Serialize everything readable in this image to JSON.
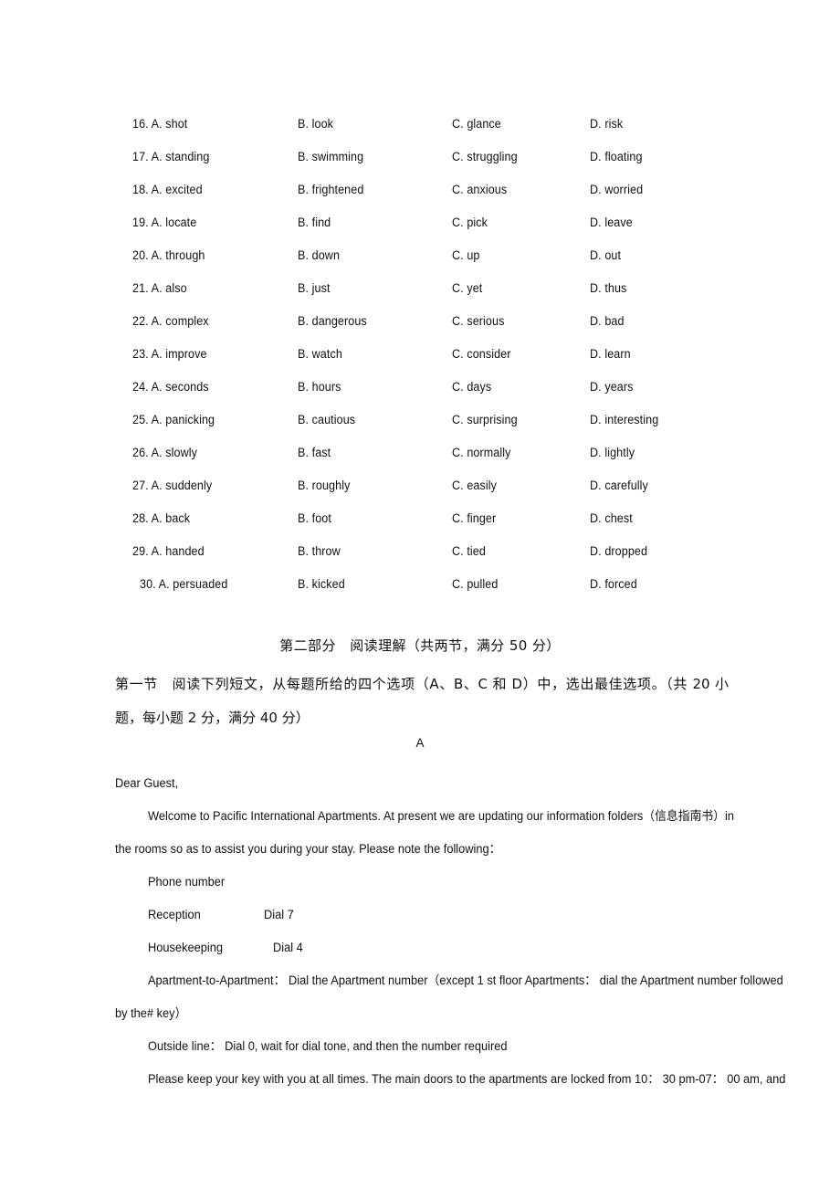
{
  "cloze": {
    "columns": [
      "A",
      "B",
      "C",
      "D"
    ],
    "rows": [
      {
        "number": "16.",
        "a": "16. A. shot",
        "b": "B. look",
        "c": "C. glance",
        "d": "D. risk"
      },
      {
        "number": "17.",
        "a": "17. A. standing",
        "b": "B. swimming",
        "c": "C. struggling",
        "d": "D. floating"
      },
      {
        "number": "18.",
        "a": "18. A. excited",
        "b": "B. frightened",
        "c": "C. anxious",
        "d": "D. worried"
      },
      {
        "number": "19.",
        "a": "19. A. locate",
        "b": "B. find",
        "c": "C. pick",
        "d": "D. leave"
      },
      {
        "number": "20.",
        "a": "20. A. through",
        "b": "B. down",
        "c": "C. up",
        "d": "D. out"
      },
      {
        "number": "21.",
        "a": "21. A. also",
        "b": "B. just",
        "c": "C. yet",
        "d": "D. thus"
      },
      {
        "number": "22.",
        "a": "22. A. complex",
        "b": "B. dangerous",
        "c": "C. serious",
        "d": "D. bad"
      },
      {
        "number": "23.",
        "a": "23. A. improve",
        "b": "B. watch",
        "c": "C. consider",
        "d": "D. learn"
      },
      {
        "number": "24.",
        "a": "24. A. seconds",
        "b": "B. hours",
        "c": "C. days",
        "d": "D. years"
      },
      {
        "number": "25.",
        "a": "25. A. panicking",
        "b": "B. cautious",
        "c": "C. surprising",
        "d": "D. interesting"
      },
      {
        "number": "26.",
        "a": "26. A. slowly",
        "b": "B. fast",
        "c": "C. normally",
        "d": "D. lightly"
      },
      {
        "number": "27.",
        "a": "27. A. suddenly",
        "b": "B. roughly",
        "c": "C. easily",
        "d": "D. carefully"
      },
      {
        "number": "28.",
        "a": "28. A. back",
        "b": "B. foot",
        "c": "C. finger",
        "d": "D. chest"
      },
      {
        "number": "29.",
        "a": "29. A. handed",
        "b": "B. throw",
        "c": "C. tied",
        "d": "D. dropped"
      },
      {
        "number": "30.",
        "a": "30. A. persuaded",
        "b": "B. kicked",
        "c": "C. pulled",
        "d": "D. forced"
      }
    ]
  },
  "part_two": {
    "heading": "第二部分　阅读理解（共两节，满分 50 分）",
    "section_one_intro": "第一节　阅读下列短文，从每题所给的四个选项（A、B、C 和 D）中，选出最佳选项。（共 20 小题，每小题 2 分，满分 40 分）",
    "passage_label": "A"
  },
  "letter": {
    "salutation": "Dear Guest,",
    "paragraph_1_line_1": "Welcome to Pacific International Apartments. At present we are updating our information folders（信息指南书）in",
    "paragraph_1_line_2": "the rooms so as to assist you during your stay. Please note the following：",
    "phone_heading": "Phone number",
    "contacts": [
      {
        "label": "Reception",
        "value": "Dial 7"
      },
      {
        "label": "Housekeeping",
        "value": "Dial 4"
      }
    ],
    "apartment_line_1": "Apartment-to-Apartment：  Dial the Apartment number（except 1 st floor Apartments：  dial the Apartment number followed",
    "apartment_line_2": "by the# key）",
    "outside_line": "Outside line：  Dial 0, wait for dial tone, and then the number required",
    "closing_line": "Please keep your key with you at all times. The main doors to the apartments are locked from 10：  30 pm-07：  00 am, and"
  }
}
